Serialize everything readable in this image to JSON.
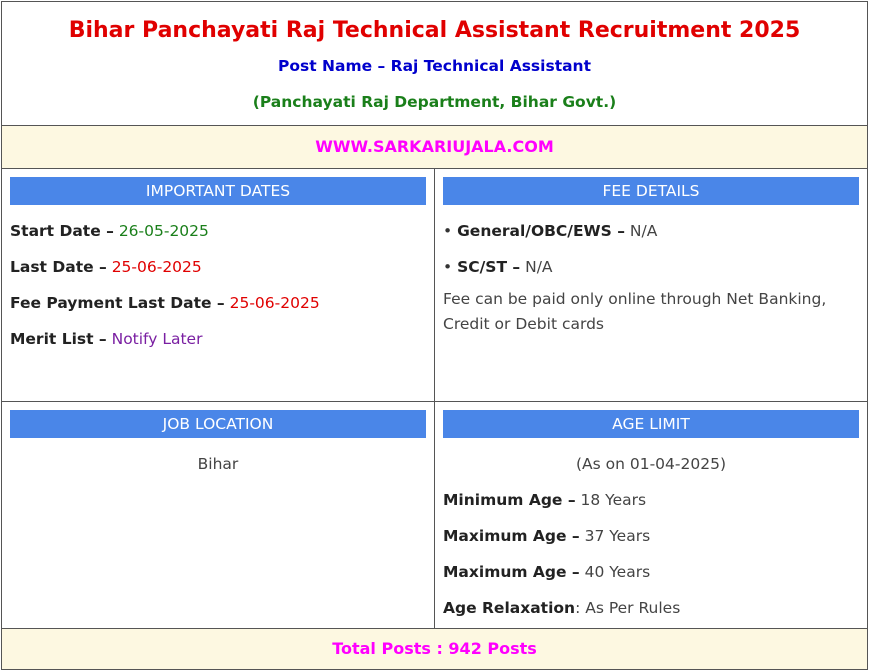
{
  "header": {
    "title": "Bihar Panchayati Raj Technical Assistant Recruitment 2025",
    "post_name": "Post Name – Raj Technical Assistant",
    "department": "(Panchayati Raj Department, Bihar Govt.)"
  },
  "website": "WWW.SARKARIUJALA.COM",
  "important_dates": {
    "heading": "IMPORTANT DATES",
    "rows": [
      {
        "label": "Start Date –",
        "value": " 26-05-2025"
      },
      {
        "label": "Last Date –",
        "value": " 25-06-2025"
      },
      {
        "label": "Fee Payment Last Date –",
        "value": " 25-06-2025"
      },
      {
        "label": "Merit List –",
        "value": " Notify Later"
      }
    ]
  },
  "fee_details": {
    "heading": "FEE DETAILS",
    "rows": [
      {
        "bullet": "• ",
        "label": "General/OBC/EWS –",
        "value": " N/A"
      },
      {
        "bullet": "• ",
        "label": "SC/ST –",
        "value": " N/A"
      }
    ],
    "note": "Fee can be paid only online through Net Banking, Credit or Debit cards"
  },
  "job_location": {
    "heading": "JOB LOCATION",
    "value": "Bihar"
  },
  "age_limit": {
    "heading": "AGE LIMIT",
    "as_on": "(As on 01-04-2025)",
    "rows": [
      {
        "label": "Minimum Age –",
        "value": " 18 Years"
      },
      {
        "label": "Maximum Age –",
        "value": " 37 Years"
      },
      {
        "label": "Maximum Age –",
        "value": " 40 Years"
      },
      {
        "label": "Age Relaxation",
        "value": ": As Per Rules"
      }
    ]
  },
  "total_posts": "Total Posts : 942 Posts",
  "colors": {
    "title": "#e00000",
    "post_name": "#0000cc",
    "department": "#1a7f1a",
    "highlight": "#ff00ff",
    "header_bar": "#4a86e8",
    "band_background": "#fdf8e1"
  }
}
